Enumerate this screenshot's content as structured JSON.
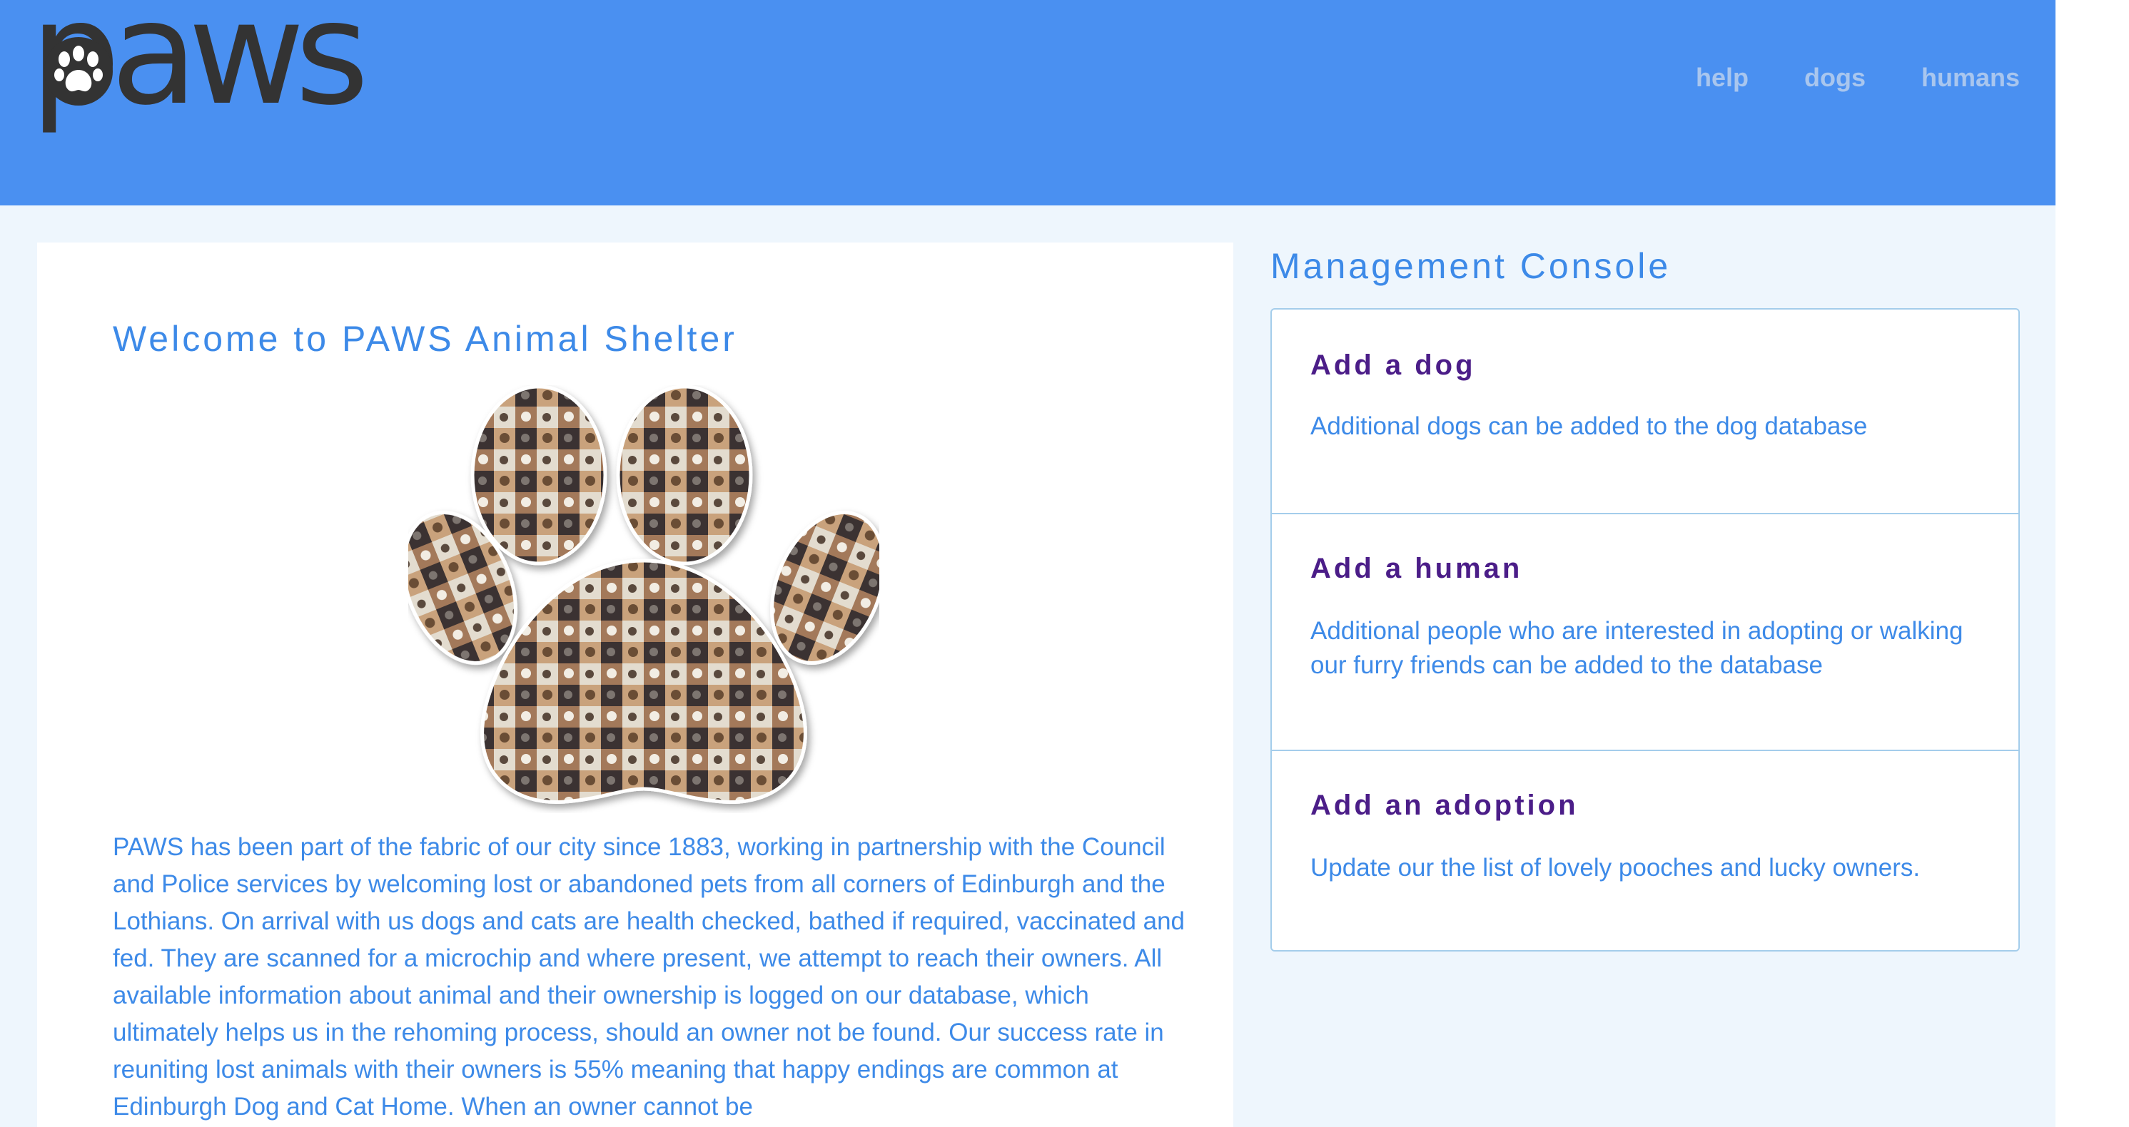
{
  "header": {
    "logo_text": "paws",
    "nav": [
      "help",
      "dogs",
      "humans"
    ]
  },
  "main": {
    "title": "Welcome to PAWS Animal Shelter",
    "intro": "PAWS has been part of the fabric of our city since 1883, working in partnership with the Council and Police services by welcoming lost or abandoned pets from all corners of Edinburgh and the Lothians. On arrival with us dogs and cats are health checked, bathed if required, vaccinated and fed. They are scanned for a microchip and where present, we attempt to reach their owners. All available information about animal and their ownership is logged on our database, which ultimately helps us in the rehoming process, should an owner not be found. Our success rate in reuniting lost animals with their owners is 55% meaning that happy endings are common at Edinburgh Dog and Cat Home. When an owner cannot be"
  },
  "console": {
    "title": "Management Console",
    "items": [
      {
        "title": "Add a dog",
        "description": "Additional dogs can be added to the dog database"
      },
      {
        "title": "Add a human",
        "description": "Additional people who are interested in adopting or walking our furry friends can be added to the database"
      },
      {
        "title": "Add an adoption",
        "description": "Update our the list of lovely pooches and lucky owners."
      }
    ]
  },
  "colors": {
    "header_bg": "#4a90f1",
    "nav_link": "#a9c6ee",
    "accent_blue": "#3d8ae8",
    "item_title_purple": "#4b1d88",
    "page_bg": "#eef6fd",
    "panel_border": "#a4cdeb"
  },
  "icons": [
    "paw-logo-icon",
    "paw-photo-collage"
  ]
}
